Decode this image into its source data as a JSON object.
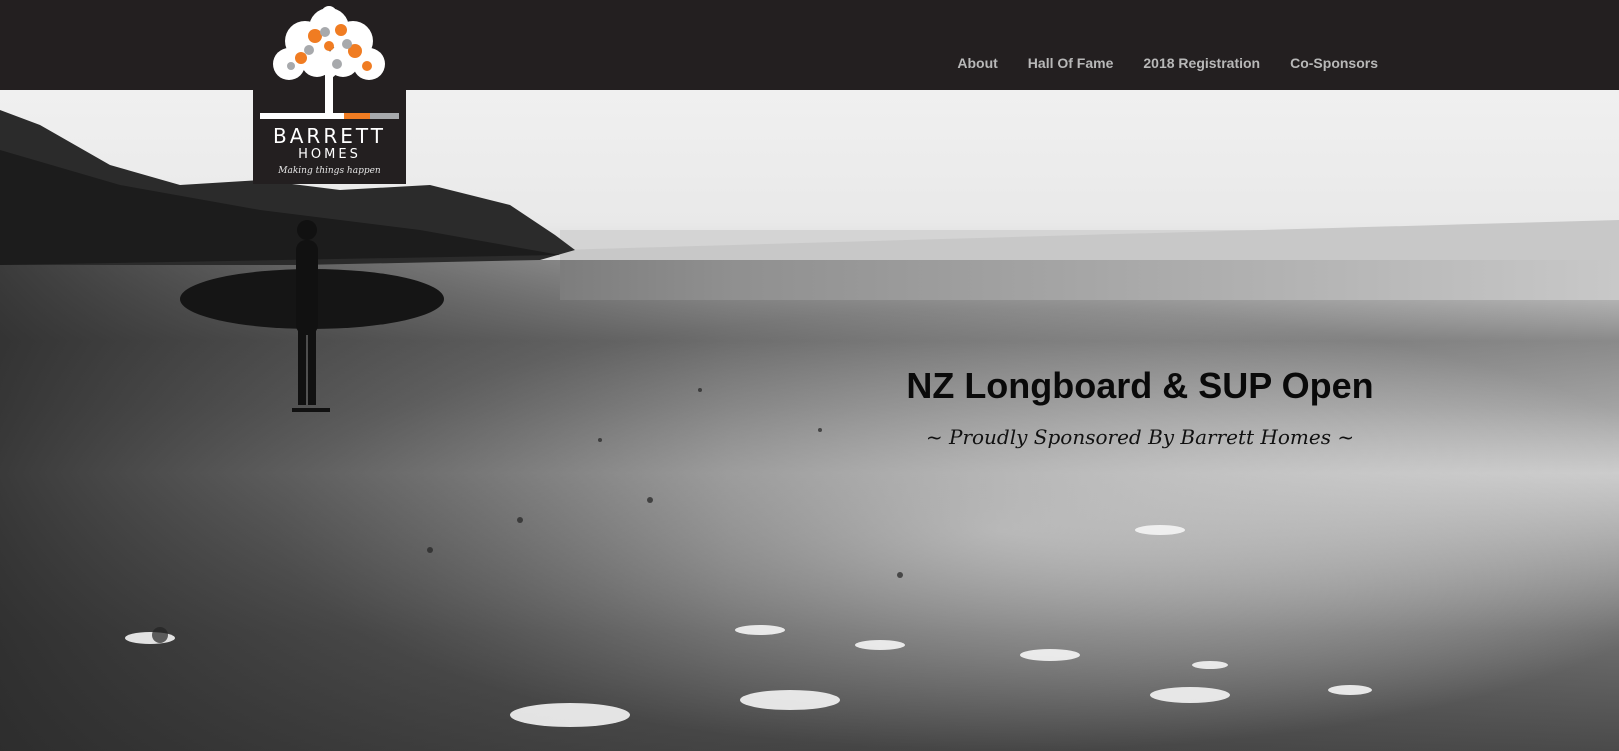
{
  "nav": {
    "items": [
      {
        "label": "About"
      },
      {
        "label": "Hall Of Fame"
      },
      {
        "label": "2018 Registration"
      },
      {
        "label": "Co-Sponsors"
      }
    ]
  },
  "logo": {
    "brand": "BARRETT",
    "sub": "HOMES",
    "tagline": "Making things happen",
    "colors": {
      "orange": "#f07c22",
      "grey": "#a7a9ac",
      "white": "#ffffff",
      "background": "#231f20"
    }
  },
  "hero": {
    "title": "NZ Longboard & SUP Open",
    "subtitle": "~ Proudly Sponsored By Barrett Homes ~"
  },
  "colors": {
    "navbar_bg": "#231f20",
    "nav_text": "#b8b8b8"
  }
}
